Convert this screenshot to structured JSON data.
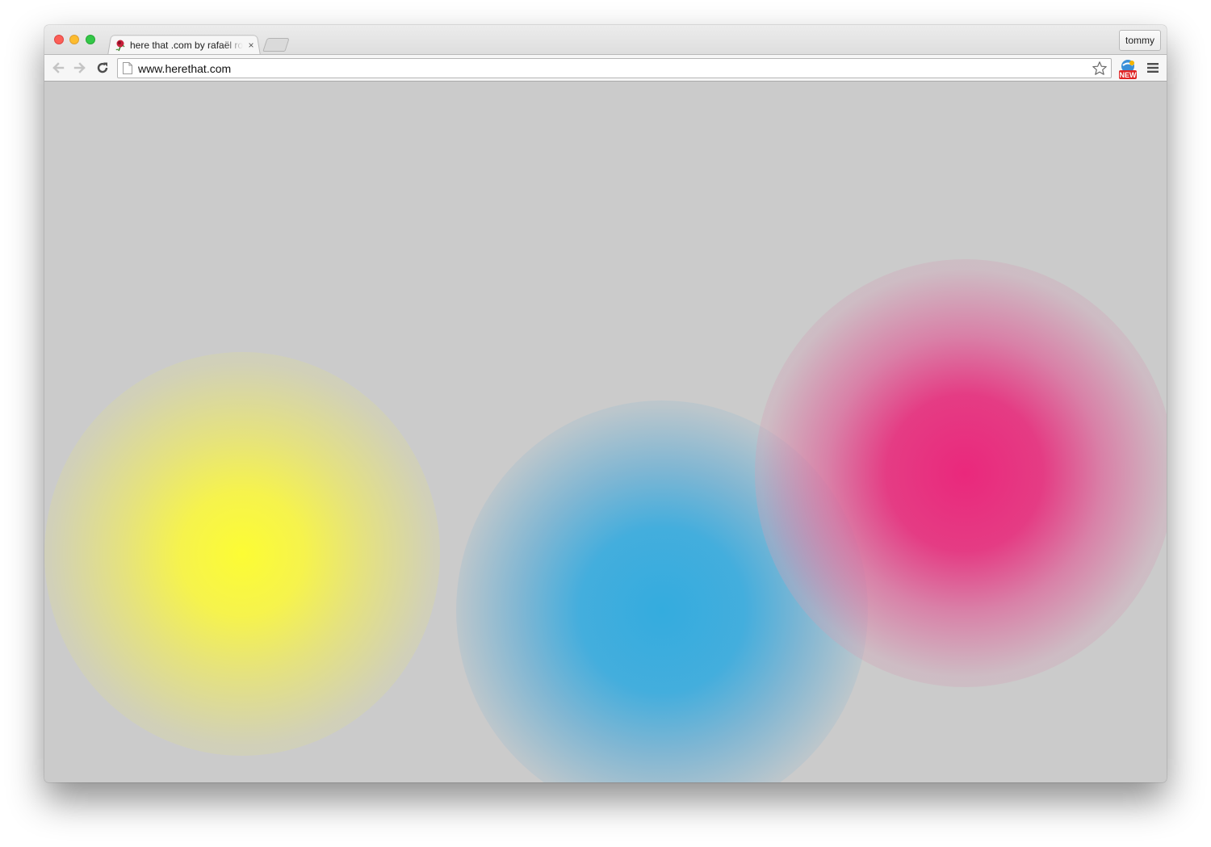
{
  "window": {
    "controls": [
      "close",
      "minimize",
      "zoom"
    ]
  },
  "tabs": [
    {
      "title": "here that .com by rafaël ro",
      "favicon": "rose-icon",
      "close_label": "×"
    }
  ],
  "profile": {
    "name": "tommy"
  },
  "toolbar": {
    "back_icon": "back-arrow-icon",
    "forward_icon": "forward-arrow-icon",
    "reload_icon": "reload-icon",
    "url": "www.herethat.com",
    "bookmark_icon": "star-icon",
    "extension_badge": "NEW",
    "menu_icon": "hamburger-menu-icon"
  },
  "content": {
    "background": "#cbcbcb",
    "blobs": [
      {
        "name": "yellow-blob",
        "color": "#fcfc34"
      },
      {
        "name": "blue-blob",
        "color": "#34acde"
      },
      {
        "name": "pink-blob",
        "color": "#ea287c"
      }
    ]
  }
}
